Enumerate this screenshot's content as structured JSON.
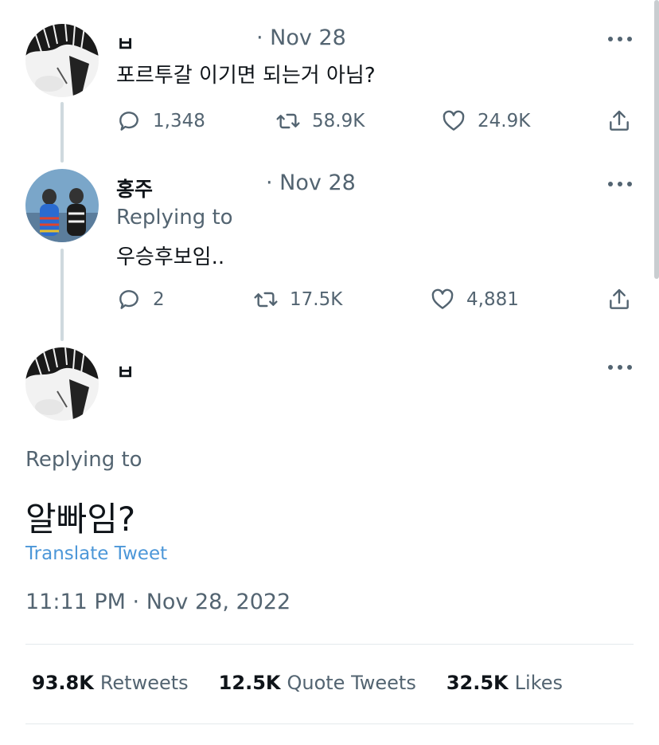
{
  "tweets": [
    {
      "author": "ㅂ",
      "date": "· Nov 28",
      "text": "포르투갈 이기면 되는거 아님?",
      "replies": "1,348",
      "retweets": "58.9K",
      "likes": "24.9K"
    },
    {
      "author": "홍주",
      "date": "· Nov 28",
      "replying_to": "Replying to",
      "text": "우승후보임..",
      "replies": "2",
      "retweets": "17.5K",
      "likes": "4,881"
    }
  ],
  "main_tweet": {
    "author": "ㅂ",
    "replying_to": "Replying to",
    "text": "알빠임?",
    "translate_label": "Translate Tweet",
    "timestamp": "11:11 PM · Nov 28, 2022",
    "stats": {
      "retweets_count": "93.8K",
      "retweets_label": "Retweets",
      "quotes_count": "12.5K",
      "quotes_label": "Quote Tweets",
      "likes_count": "32.5K",
      "likes_label": "Likes"
    }
  },
  "icons": {
    "reply": "reply-icon",
    "retweet": "retweet-icon",
    "like": "heart-icon",
    "share": "share-icon",
    "more": "more-icon"
  },
  "colors": {
    "text_primary": "#0f1419",
    "text_secondary": "#536471",
    "link": "#4c97d8",
    "thread_line": "#cfd9de"
  }
}
